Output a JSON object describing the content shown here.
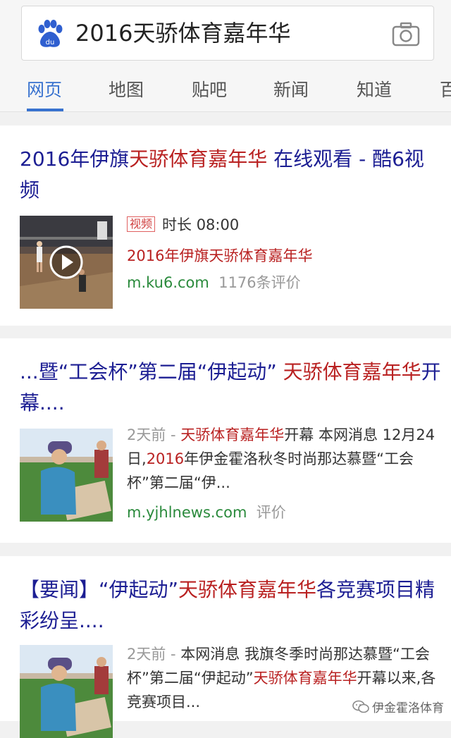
{
  "search": {
    "query": "2016天骄体育嘉年华"
  },
  "tabs": [
    "网页",
    "地图",
    "贴吧",
    "新闻",
    "知道",
    "百"
  ],
  "results": [
    {
      "title_pre": "2016年伊旗",
      "title_hl": "天骄体育嘉年华",
      "title_post": " 在线观看 - 酷6视频",
      "badge": "视频",
      "duration": "时长 08:00",
      "desc_pre": "2016年伊旗",
      "desc_hl": "天骄体育嘉年华",
      "url": "m.ku6.com",
      "reviews": "1176条评价"
    },
    {
      "title_pre": "...暨“工会杯”第二届“伊起动” ",
      "title_hl": "天骄体育嘉年华",
      "title_post": "开幕....",
      "time": "2天前 - ",
      "snippet_hl1": "天骄体育嘉年华",
      "snippet_mid": "开幕 本网消息 12月24日,",
      "snippet_hl2": "2016",
      "snippet_post": "年伊金霍洛秋冬时尚那达慕暨“工会杯”第二届“伊...",
      "url": "m.yjhlnews.com",
      "reviews": "评价"
    },
    {
      "title_pre": "【要闻】“伊起动”",
      "title_hl": "天骄体育嘉年华",
      "title_post": "各竞赛项目精彩纷呈....",
      "time": "2天前 - ",
      "snippet_pre": "本网消息 我旗冬季时尚那达慕暨“工会杯”第二届“伊起动”",
      "snippet_hl": "天骄体育嘉年华",
      "snippet_post": "开幕以来,各竞赛项目..."
    }
  ],
  "watermark": "伊金霍洛体育"
}
